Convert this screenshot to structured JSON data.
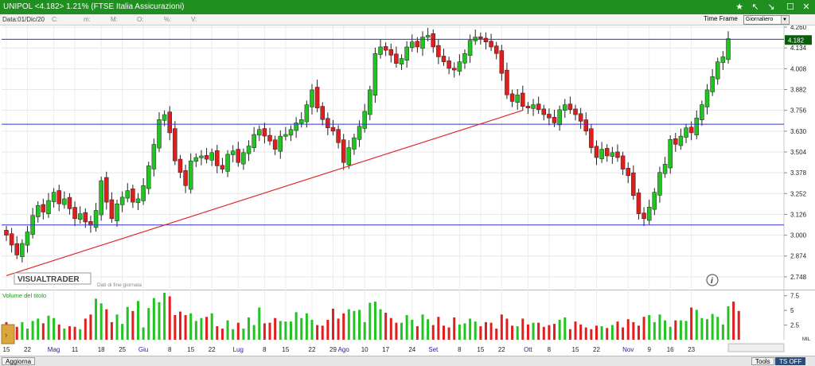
{
  "window": {
    "title": "UNIPOL <4.182> 1.21%  (FTSE Italia Assicurazioni)"
  },
  "infobar": {
    "data_label": "Data:01/Dic/20",
    "fields": [
      "C:",
      "m:",
      "M:",
      "O:",
      "%:",
      "V:"
    ]
  },
  "timeframe": {
    "label": "Time Frame",
    "value": "Giornaliero"
  },
  "watermark": {
    "brand": "VISUALTRADER",
    "subtitle": "Dati di fine giornata"
  },
  "statusbar": {
    "left": "Aggiorna",
    "tools": "Tools",
    "ts": "TS OFF"
  },
  "colors": {
    "up": "#21c421",
    "down": "#e01e1e",
    "hline": "#3333cc",
    "trend": "#e02a2a",
    "last_price_bg": "#0b5c0b"
  },
  "chart_data": {
    "type": "candlestick",
    "symbol": "UNIPOL",
    "last_price": "4.182",
    "price_axis": {
      "ylim": [
        2.68,
        4.27
      ],
      "ticks": [
        "2.748",
        "2.874",
        "3.000",
        "3.126",
        "3.252",
        "3.378",
        "3.504",
        "3.630",
        "3.756",
        "3.882",
        "4.008",
        "4.134",
        "4.260"
      ]
    },
    "horizontal_lines": [
      4.186,
      3.672,
      3.062
    ],
    "trend_line": [
      [
        0,
        2.755
      ],
      [
        98,
        3.756
      ]
    ],
    "closes": [
      3.0,
      2.94,
      2.88,
      2.95,
      3.02,
      3.12,
      3.18,
      3.14,
      3.21,
      3.26,
      3.19,
      3.22,
      3.16,
      3.1,
      3.13,
      3.08,
      3.06,
      3.15,
      3.33,
      3.2,
      3.1,
      3.19,
      3.23,
      3.27,
      3.2,
      3.22,
      3.3,
      3.42,
      3.55,
      3.7,
      3.73,
      3.62,
      3.45,
      3.38,
      3.3,
      3.45,
      3.47,
      3.48,
      3.46,
      3.5,
      3.42,
      3.4,
      3.49,
      3.51,
      3.44,
      3.5,
      3.54,
      3.61,
      3.64,
      3.6,
      3.57,
      3.52,
      3.6,
      3.61,
      3.64,
      3.68,
      3.7,
      3.79,
      3.88,
      3.77,
      3.7,
      3.65,
      3.63,
      3.56,
      3.44,
      3.53,
      3.59,
      3.66,
      3.75,
      3.88,
      4.1,
      4.14,
      4.12,
      4.09,
      4.04,
      4.07,
      4.14,
      4.17,
      4.14,
      4.2,
      4.21,
      4.14,
      4.08,
      4.05,
      4.01,
      4.0,
      4.05,
      4.1,
      4.18,
      4.2,
      4.19,
      4.17,
      4.14,
      4.1,
      3.98,
      3.85,
      3.81,
      3.85,
      3.78,
      3.77,
      3.79,
      3.76,
      3.73,
      3.71,
      3.68,
      3.76,
      3.79,
      3.76,
      3.73,
      3.69,
      3.63,
      3.53,
      3.47,
      3.52,
      3.48,
      3.5,
      3.47,
      3.4,
      3.36,
      3.24,
      3.13,
      3.1,
      3.17,
      3.26,
      3.38,
      3.43,
      3.58,
      3.55,
      3.6,
      3.65,
      3.62,
      3.71,
      3.79,
      3.88,
      3.96,
      4.05,
      4.08,
      4.19
    ],
    "volume": {
      "label": "Volume del titolo",
      "ylim": [
        0,
        8
      ],
      "ticks": [
        "2.5",
        "5",
        "7.5"
      ],
      "unit_label": "MIL",
      "values": [
        3,
        1.8,
        2.2,
        3,
        1.9,
        3.2,
        3.6,
        2.8,
        4.1,
        3.7,
        2.6,
        1.9,
        2.3,
        2.2,
        1.8,
        3.6,
        4.3,
        7,
        6.2,
        5.2,
        3,
        4.3,
        2.7,
        5.6,
        4.9,
        6.6,
        2.1,
        5.4,
        7.1,
        6.4,
        8,
        7.4,
        4.2,
        4.8,
        4.2,
        4.5,
        3.2,
        3.7,
        3.9,
        4.5,
        2.3,
        1.9,
        3.3,
        1.8,
        2.9,
        1.9,
        3.8,
        2.5,
        5.5,
        2.8,
        2.9,
        3.7,
        3.2,
        3.1,
        3.1,
        4.7,
        3.7,
        4.5,
        3.4,
        2.5,
        2.4,
        3.4,
        5.3,
        3.6,
        4.5,
        5.2,
        4.9,
        5.1,
        3,
        6.3,
        6.5,
        5.2,
        4.6,
        3.7,
        2.9,
        2.9,
        4.2,
        3.4,
        2.3,
        4.3,
        3.5,
        2.5,
        3.9,
        2.4,
        2.1,
        3.8,
        2.6,
        2.8,
        3.6,
        3.1,
        2.3,
        3,
        2.9,
        1.9,
        4.3,
        3.6,
        2.4,
        2.3,
        3.6,
        2.6,
        2.9,
        2.9,
        2.2,
        2.5,
        2.7,
        3.4,
        3.8,
        1.8,
        3.1,
        2.6,
        2.1,
        1.8,
        2.4,
        2.3,
        2,
        2.5,
        3.1,
        2.1,
        3.5,
        3,
        2.4,
        3.9,
        4.2,
        3,
        4.3,
        3.3,
        2.2,
        3.3,
        3.3,
        3.2,
        5.5,
        5.1,
        3.7,
        3.5,
        4.4,
        3.9,
        2.6,
        5.7,
        6.5,
        4.9
      ]
    },
    "x_labels": [
      {
        "i": 0,
        "t": "15"
      },
      {
        "i": 4,
        "t": "22"
      },
      {
        "i": 9,
        "t": "Mag"
      },
      {
        "i": 13,
        "t": "11"
      },
      {
        "i": 18,
        "t": "18"
      },
      {
        "i": 22,
        "t": "25"
      },
      {
        "i": 26,
        "t": "Giu"
      },
      {
        "i": 31,
        "t": "8"
      },
      {
        "i": 35,
        "t": "15"
      },
      {
        "i": 39,
        "t": "22"
      },
      {
        "i": 44,
        "t": "Lug"
      },
      {
        "i": 49,
        "t": "8"
      },
      {
        "i": 53,
        "t": "15"
      },
      {
        "i": 58,
        "t": "22"
      },
      {
        "i": 62,
        "t": "29"
      },
      {
        "i": 64,
        "t": "Ago"
      },
      {
        "i": 68,
        "t": "10"
      },
      {
        "i": 72,
        "t": "17"
      },
      {
        "i": 77,
        "t": "24"
      },
      {
        "i": 81,
        "t": "Set"
      },
      {
        "i": 86,
        "t": "8"
      },
      {
        "i": 90,
        "t": "15"
      },
      {
        "i": 94,
        "t": "22"
      },
      {
        "i": 99,
        "t": "Ott"
      },
      {
        "i": 103,
        "t": "8"
      },
      {
        "i": 108,
        "t": "15"
      },
      {
        "i": 112,
        "t": "22"
      },
      {
        "i": 118,
        "t": "Nov"
      },
      {
        "i": 122,
        "t": "9"
      },
      {
        "i": 126,
        "t": "16"
      },
      {
        "i": 130,
        "t": "23"
      }
    ]
  }
}
